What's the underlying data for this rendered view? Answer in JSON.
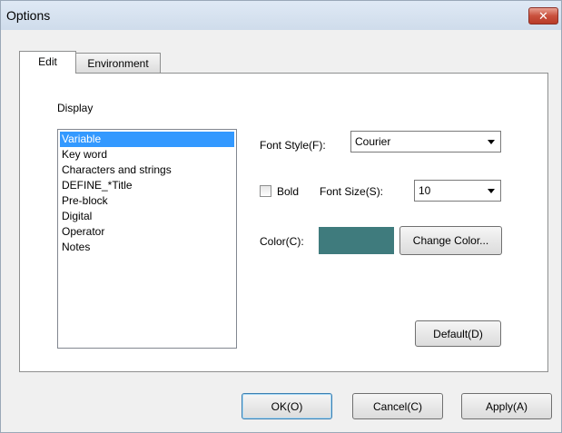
{
  "window": {
    "title": "Options"
  },
  "tabs": [
    {
      "label": "Edit"
    },
    {
      "label": "Environment"
    }
  ],
  "display": {
    "label": "Display",
    "items": [
      {
        "label": "Variable"
      },
      {
        "label": "Key word"
      },
      {
        "label": "Characters and strings"
      },
      {
        "label": "DEFINE_*Title"
      },
      {
        "label": "Pre-block"
      },
      {
        "label": "Digital"
      },
      {
        "label": "Operator"
      },
      {
        "label": "Notes"
      }
    ],
    "selected": "Variable"
  },
  "font_style": {
    "label": "Font Style(F):",
    "value": "Courier"
  },
  "bold": {
    "label": "Bold",
    "checked": false
  },
  "font_size": {
    "label": "Font Size(S):",
    "value": "10"
  },
  "color": {
    "label": "Color(C):",
    "value": "#3f7b7d",
    "change_label": "Change Color..."
  },
  "buttons": {
    "default": "Default(D)",
    "ok": "OK(O)",
    "cancel": "Cancel(C)",
    "apply": "Apply(A)"
  },
  "icons": {
    "close": "close-icon"
  }
}
